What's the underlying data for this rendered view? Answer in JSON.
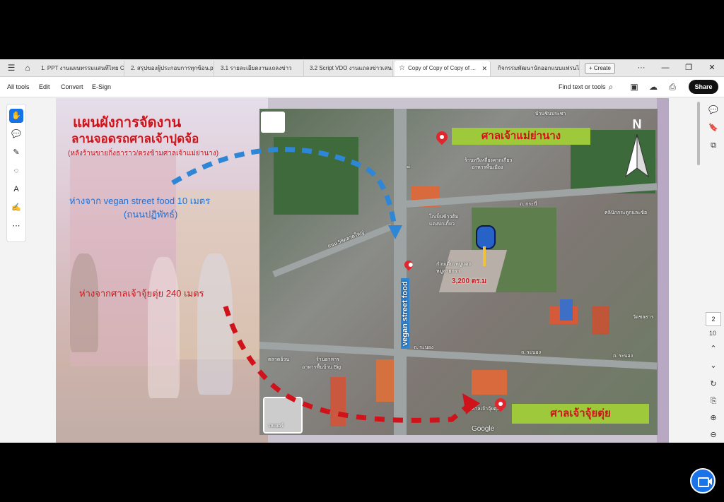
{
  "tabs": [
    {
      "label": "1. PPT งานแผนทรรมแสนทีไทย Con..."
    },
    {
      "label": "2. สรุปของผู้ประกอบการทุกข้อน.pdf"
    },
    {
      "label": "3.1 รายละเอียดงานแถลงข่าว"
    },
    {
      "label": "3.2 Script VDO งานแถลงข่าวเสน..."
    },
    {
      "label": "Copy of Copy of Copy of ..."
    },
    {
      "label": "กิจกรรมพัฒนานักออกแบบแฟรนไ..."
    }
  ],
  "create_label": "Create",
  "menu": {
    "all_tools": "All tools",
    "edit": "Edit",
    "convert": "Convert",
    "esign": "E-Sign"
  },
  "find_label": "Find text or tools",
  "share_label": "Share",
  "page": {
    "current": "2",
    "total": "10"
  },
  "slide": {
    "title_line1": "แผนผังการจัดงาน",
    "title_line2": "ลานจอดรถศาลเจ้าปุดจ้อ",
    "subtitle": "(หลังร้านขายกิ่งธาราว/ตรงข้ามศาลเจ้าแม่ย่านาง)",
    "distance_vegan_1": "ห่างจาก vegan street food 10 เมตร",
    "distance_vegan_2": "(ถนนปฏิพัทธ์)",
    "distance_shrine": "ห่างจากศาลเจ้าจุ้ยตุ่ย 240 เมตร"
  },
  "map": {
    "label_top": "ศาลเจ้าแม่ย่านาง",
    "label_bottom": "ศาลเจ้าจุ้ยตุ่ย",
    "north": "N",
    "area": "3,200 ตร.ม",
    "vertical_road": "vegan street food",
    "road_krabi": "ถ. กระบี่",
    "road_ranong": "ถ. ระนอง",
    "road_ranong2": "ถ. ระนอง",
    "road_ranong3": "ถ. ระนอง",
    "road_soi": "ถนน 58ตลาดใหญ่",
    "place_1": "บ้านชินประชา",
    "place_2": "ร้านทวีเหลี่ยงคากเกี่ยว",
    "place_3": "อาหารพื้นเมือง",
    "place_4": "โกเบ็นข้าวต้ม",
    "place_5": "แคงปกเกี้ยว",
    "place_6": "ก๋วยเตี๋ยวหมูแดง",
    "place_7": "หมูสายกรา",
    "place_8": "คลินิกกระดูกและข้อ",
    "place_9": "วัดชลธาร",
    "place_10": "ตลาดอ้วน",
    "place_11": "ร้านอาหาร",
    "place_12": "อาหารพื้นบ้าน Big",
    "place_13": "ศาลเจ้าจุ้ยตุ่ย",
    "google": "Google",
    "layers": "เลเยอร์"
  },
  "colors": {
    "accent": "#1473e6",
    "title_red": "#d0131b",
    "label_green": "#9ec93a",
    "route_blue": "#2e86d6",
    "route_red": "#d0131b"
  }
}
